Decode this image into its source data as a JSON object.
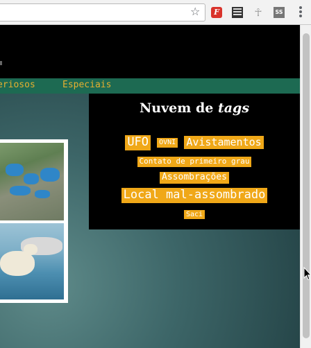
{
  "nav": {
    "items": [
      "eriosos",
      "Especiais"
    ]
  },
  "tag_cloud": {
    "title_prefix": "Nuvem de ",
    "title_em": "tags",
    "tags": [
      "UFO",
      "OVNI",
      "Avistamentos",
      "Contato de primeiro grau",
      "Assombrações",
      "Local mal-assombrado",
      "Saci"
    ]
  },
  "extensions": {
    "red_label": "F",
    "ss_label": "SS",
    "ankh": "☥"
  },
  "colors": {
    "tag_bg": "#f0a818",
    "nav_bg": "#1d6a52",
    "nav_text": "#e6b030"
  },
  "icons": [
    "star-icon",
    "extension-icon",
    "film-icon",
    "ankh-icon",
    "ss-icon",
    "menu-icon",
    "cursor-icon"
  ]
}
